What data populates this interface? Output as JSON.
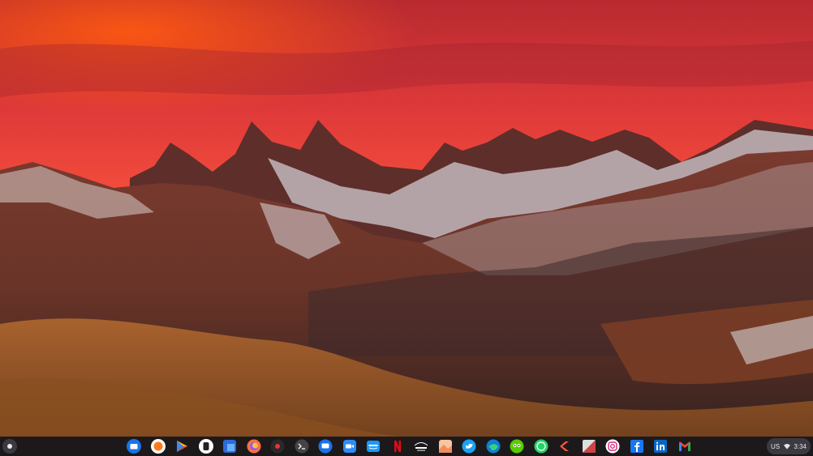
{
  "wallpaper": {
    "description_icon": "mountain-wallpaper"
  },
  "shelf": {
    "launcher_icon": "launcher-circle-icon",
    "apps": [
      {
        "name": "files",
        "icon": "folder-icon"
      },
      {
        "name": "fennec",
        "icon": "fox-icon"
      },
      {
        "name": "play-store",
        "icon": "play-triangle-icon"
      },
      {
        "name": "app-black",
        "icon": "app-icon"
      },
      {
        "name": "screenshot",
        "icon": "screen-capture-icon"
      },
      {
        "name": "firefox",
        "icon": "firefox-icon"
      },
      {
        "name": "obs",
        "icon": "record-icon"
      },
      {
        "name": "terminal",
        "icon": "terminal-icon"
      },
      {
        "name": "messages",
        "icon": "chat-icon"
      },
      {
        "name": "zoom",
        "icon": "video-camera-icon"
      },
      {
        "name": "prime-video",
        "icon": "prime-video-icon"
      },
      {
        "name": "netflix",
        "icon": "netflix-icon"
      },
      {
        "name": "disney-hotstar",
        "icon": "hotstar-icon"
      },
      {
        "name": "gallery",
        "icon": "gallery-icon"
      },
      {
        "name": "twitter",
        "icon": "twitter-bird-icon"
      },
      {
        "name": "edge",
        "icon": "edge-icon"
      },
      {
        "name": "duolingo",
        "icon": "duolingo-owl-icon"
      },
      {
        "name": "whatsapp",
        "icon": "whatsapp-icon"
      },
      {
        "name": "kotlin-app",
        "icon": "arrow-k-icon"
      },
      {
        "name": "photo-app",
        "icon": "photo-icon"
      },
      {
        "name": "instagram",
        "icon": "instagram-icon"
      },
      {
        "name": "facebook",
        "icon": "facebook-icon"
      },
      {
        "name": "linkedin",
        "icon": "linkedin-icon"
      },
      {
        "name": "gmail",
        "icon": "gmail-icon"
      }
    ],
    "tray": {
      "locale": "US",
      "time": "3:34",
      "wifi_icon": "wifi-icon"
    }
  },
  "colors": {
    "shelf_bg": "#16161a",
    "sky_top": "#c9303a",
    "sky_glow": "#ff5a2c"
  }
}
